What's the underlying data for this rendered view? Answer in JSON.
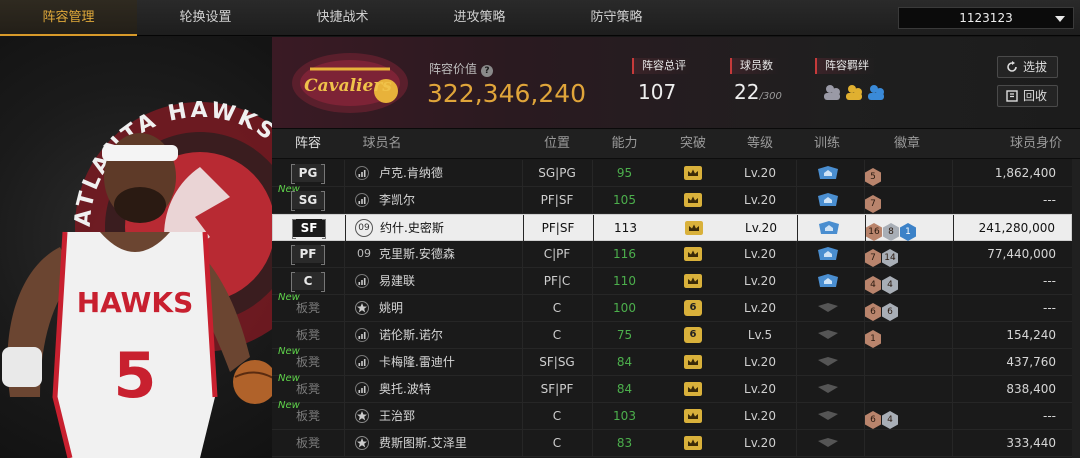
{
  "tabs": [
    {
      "label": "阵容管理",
      "active": true
    },
    {
      "label": "轮换设置",
      "active": false
    },
    {
      "label": "快捷战术",
      "active": false
    },
    {
      "label": "进攻策略",
      "active": false
    },
    {
      "label": "防守策略",
      "active": false
    }
  ],
  "account": {
    "id": "1123123"
  },
  "showcase": {
    "team_ring_text": "ATLANTA HAWKS",
    "jersey_text": "HAWKS",
    "jersey_number": "5"
  },
  "team": {
    "logo_text": "Cavaliers",
    "value_label": "阵容价值",
    "value": "322,346,240"
  },
  "stats": {
    "rating_label": "阵容总评",
    "rating": "107",
    "players_label": "球员数",
    "players": "22",
    "players_max": "/300",
    "bond_label": "阵容羁绊"
  },
  "buttons": {
    "pick": "选拔",
    "recycle": "回收"
  },
  "columns": [
    "阵容",
    "球员名",
    "位置",
    "能力",
    "突破",
    "等级",
    "训练",
    "徽章",
    "球员身价"
  ],
  "rows": [
    {
      "slot": "PG",
      "new": "",
      "name": "卢克.肯纳德",
      "jersey": "",
      "pos": "SG|PG",
      "ability": "95",
      "breakthrough": "",
      "level": "Lv.20",
      "train": true,
      "badges": [
        {
          "t": "bronze",
          "n": "5"
        }
      ],
      "value": "1,862,400",
      "selected": false
    },
    {
      "slot": "SG",
      "new": "New",
      "name": "李凯尔",
      "jersey": "",
      "pos": "PF|SF",
      "ability": "105",
      "breakthrough": "",
      "level": "Lv.20",
      "train": true,
      "badges": [
        {
          "t": "bronze",
          "n": "7"
        }
      ],
      "value": "---",
      "selected": false
    },
    {
      "slot": "SF",
      "new": "",
      "name": "约什.史密斯",
      "jersey": "09",
      "pos": "PF|SF",
      "ability": "113",
      "breakthrough": "",
      "level": "Lv.20",
      "train": true,
      "badges": [
        {
          "t": "bronze",
          "n": "16"
        },
        {
          "t": "silver",
          "n": "8"
        },
        {
          "t": "blue",
          "n": "1"
        }
      ],
      "value": "241,280,000",
      "selected": true
    },
    {
      "slot": "PF",
      "new": "",
      "name": "克里斯.安德森",
      "jersey": "09",
      "pos": "C|PF",
      "ability": "116",
      "breakthrough": "",
      "level": "Lv.20",
      "train": true,
      "badges": [
        {
          "t": "bronze",
          "n": "7"
        },
        {
          "t": "silver",
          "n": "14"
        }
      ],
      "value": "77,440,000",
      "selected": false
    },
    {
      "slot": "C",
      "new": "",
      "name": "易建联",
      "jersey": "",
      "pos": "PF|C",
      "ability": "110",
      "breakthrough": "",
      "level": "Lv.20",
      "train": true,
      "badges": [
        {
          "t": "bronze",
          "n": "4"
        },
        {
          "t": "silver",
          "n": "4"
        }
      ],
      "value": "---",
      "selected": false
    },
    {
      "slot": "板凳",
      "new": "New",
      "name": "姚明",
      "jersey": "",
      "pos": "C",
      "ability": "100",
      "breakthrough": "6",
      "level": "Lv.20",
      "train": false,
      "badges": [
        {
          "t": "bronze",
          "n": "6"
        },
        {
          "t": "silver",
          "n": "6"
        }
      ],
      "value": "---",
      "selected": false
    },
    {
      "slot": "板凳",
      "new": "",
      "name": "诺伦斯.诺尔",
      "jersey": "",
      "pos": "C",
      "ability": "75",
      "breakthrough": "6",
      "level": "Lv.5",
      "train": false,
      "badges": [
        {
          "t": "bronze",
          "n": "1"
        }
      ],
      "value": "154,240",
      "selected": false
    },
    {
      "slot": "板凳",
      "new": "New",
      "name": "卡梅隆.雷迪什",
      "jersey": "",
      "pos": "SF|SG",
      "ability": "84",
      "breakthrough": "",
      "level": "Lv.20",
      "train": false,
      "badges": [],
      "value": "437,760",
      "selected": false
    },
    {
      "slot": "板凳",
      "new": "New",
      "name": "奥托.波特",
      "jersey": "",
      "pos": "SF|PF",
      "ability": "84",
      "breakthrough": "",
      "level": "Lv.20",
      "train": false,
      "badges": [],
      "value": "838,400",
      "selected": false
    },
    {
      "slot": "板凳",
      "new": "New",
      "name": "王治郅",
      "jersey": "",
      "pos": "C",
      "ability": "103",
      "breakthrough": "",
      "level": "Lv.20",
      "train": false,
      "badges": [
        {
          "t": "bronze",
          "n": "6"
        },
        {
          "t": "silver",
          "n": "4"
        }
      ],
      "value": "---",
      "selected": false
    },
    {
      "slot": "板凳",
      "new": "",
      "name": "费斯图斯.艾泽里",
      "jersey": "",
      "pos": "C",
      "ability": "83",
      "breakthrough": "",
      "level": "Lv.20",
      "train": false,
      "badges": [],
      "value": "333,440",
      "selected": false
    }
  ],
  "colors": {
    "accent": "#e0a53a",
    "green": "#4caf4c",
    "hawks_red": "#c8202f"
  }
}
